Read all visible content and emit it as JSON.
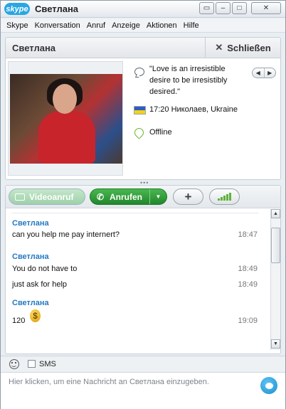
{
  "window": {
    "logo": "skype",
    "title": "Светлана",
    "buttons": [
      "tile-icon",
      "minimize-icon",
      "maximize-icon",
      "close-icon"
    ]
  },
  "menu": [
    "Skype",
    "Konversation",
    "Anruf",
    "Anzeige",
    "Aktionen",
    "Hilfe"
  ],
  "header": {
    "contact_name": "Светлана",
    "close_label": "Schließen"
  },
  "profile": {
    "mood": "\"Love is an irresistible desire to be irresistibly desired.\"",
    "location": "17:20 Николаев, Ukraine",
    "status": "Offline"
  },
  "toolbar": {
    "video_label": "Videoanruf",
    "call_label": "Anrufen",
    "add_label": "+"
  },
  "messages": [
    {
      "sender": "Светлана",
      "lines": [
        {
          "text": "can you help me pay internert?",
          "time": "18:47"
        }
      ]
    },
    {
      "sender": "Светлана",
      "lines": [
        {
          "text": "You do not have to",
          "time": "18:49"
        },
        {
          "text": "just ask for help",
          "time": "18:49"
        }
      ]
    },
    {
      "sender": "Светлана",
      "lines": [
        {
          "text": "120",
          "time": "19:09"
        }
      ]
    }
  ],
  "input": {
    "sms_label": "SMS",
    "placeholder": "Hier klicken, um eine Nachricht an Светлана einzugeben."
  },
  "colors": {
    "accent": "#2479c2",
    "call_green": "#22862c",
    "status_green": "#6bb52a"
  }
}
